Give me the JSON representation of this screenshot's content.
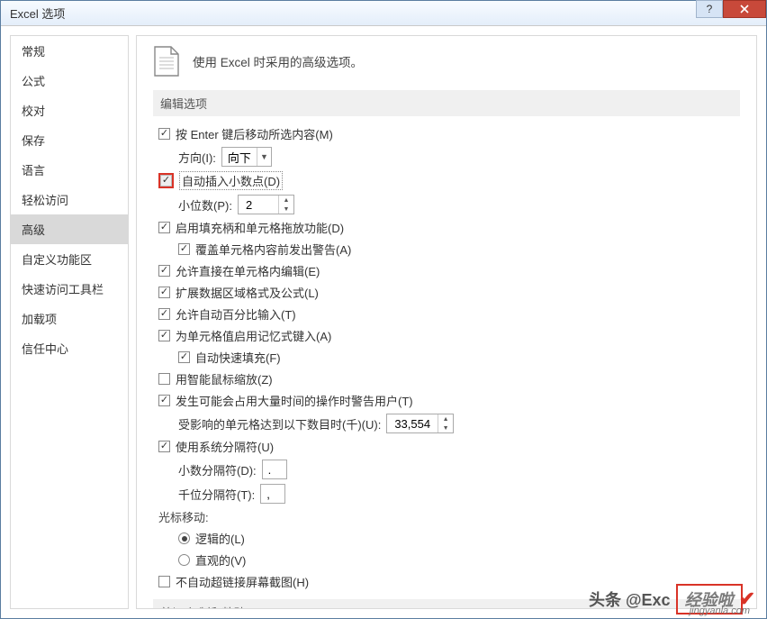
{
  "window": {
    "title": "Excel 选项"
  },
  "sidebar": {
    "items": [
      {
        "label": "常规"
      },
      {
        "label": "公式"
      },
      {
        "label": "校对"
      },
      {
        "label": "保存"
      },
      {
        "label": "语言"
      },
      {
        "label": "轻松访问"
      },
      {
        "label": "高级",
        "selected": true
      },
      {
        "label": "自定义功能区"
      },
      {
        "label": "快速访问工具栏"
      },
      {
        "label": "加载项"
      },
      {
        "label": "信任中心"
      }
    ]
  },
  "main": {
    "header": "使用 Excel 时采用的高级选项。",
    "section_edit": "编辑选项",
    "opts": {
      "enter_move": "按 Enter 键后移动所选内容(M)",
      "direction_label": "方向(I):",
      "direction_value": "向下",
      "auto_decimal": "自动插入小数点(D)",
      "decimal_places_label": "小位数(P):",
      "decimal_places_value": "2",
      "fill_handle": "启用填充柄和单元格拖放功能(D)",
      "overwrite_warn": "覆盖单元格内容前发出警告(A)",
      "edit_in_cell": "允许直接在单元格内编辑(E)",
      "extend_formats": "扩展数据区域格式及公式(L)",
      "percent_entry": "允许自动百分比输入(T)",
      "autocomplete": "为单元格值启用记忆式键入(A)",
      "flash_fill": "自动快速填充(F)",
      "intellimouse": "用智能鼠标缩放(Z)",
      "time_warn": "发生可能会占用大量时间的操作时警告用户(T)",
      "cells_threshold_label": "受影响的单元格达到以下数目时(千)(U):",
      "cells_threshold_value": "33,554",
      "system_sep": "使用系统分隔符(U)",
      "decimal_sep_label": "小数分隔符(D):",
      "decimal_sep_value": ".",
      "thousands_sep_label": "千位分隔符(T):",
      "thousands_sep_value": ",",
      "cursor_heading": "光标移动:",
      "logical": "逻辑的(L)",
      "visual": "直观的(V)",
      "no_hyperlink_screenshot": "不自动超链接屏幕截图(H)"
    },
    "section_cut": "剪切 复制和粘贴"
  },
  "watermark": {
    "toutiao": "头条 @Exc",
    "brand": "经验啦",
    "url": "jingyanla.com"
  }
}
